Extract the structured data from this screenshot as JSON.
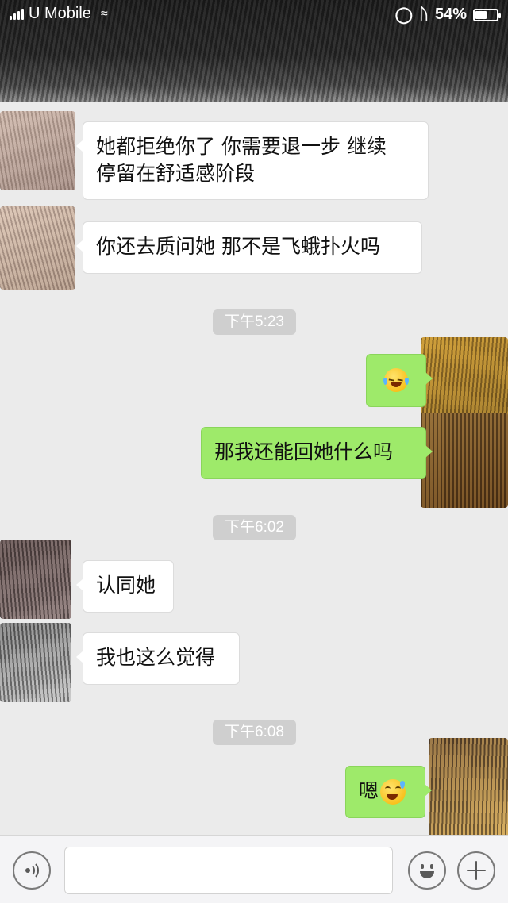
{
  "status_bar": {
    "carrier": "U Mobile",
    "time": "",
    "battery_percent_label": "54%",
    "battery_level": 0.54
  },
  "messages": [
    {
      "side": "in",
      "text": "她都拒绝你了 你需要退一步 继续\n停留在舒适感阶段"
    },
    {
      "side": "in",
      "text": "你还去质问她 那不是飞蛾扑火吗"
    },
    {
      "side": "out",
      "emoji": "laughing-crying-emoji"
    },
    {
      "side": "out",
      "text": "那我还能回她什么吗"
    },
    {
      "side": "in",
      "text": "认同她"
    },
    {
      "side": "in",
      "text": "我也这么觉得"
    },
    {
      "side": "out",
      "text": "嗯",
      "emoji": "sweat-smile-emoji"
    }
  ],
  "time_separators": [
    "下午5:23",
    "下午6:02",
    "下午6:08"
  ],
  "input_bar": {
    "placeholder": "",
    "voice_icon": "voice-icon",
    "emoji_icon": "emoji-icon",
    "plus_icon": "plus-icon"
  },
  "colors": {
    "background": "#ebebeb",
    "incoming_bubble": "#ffffff",
    "outgoing_bubble": "#9eea6a",
    "time_pill": "#cfcfcf"
  }
}
